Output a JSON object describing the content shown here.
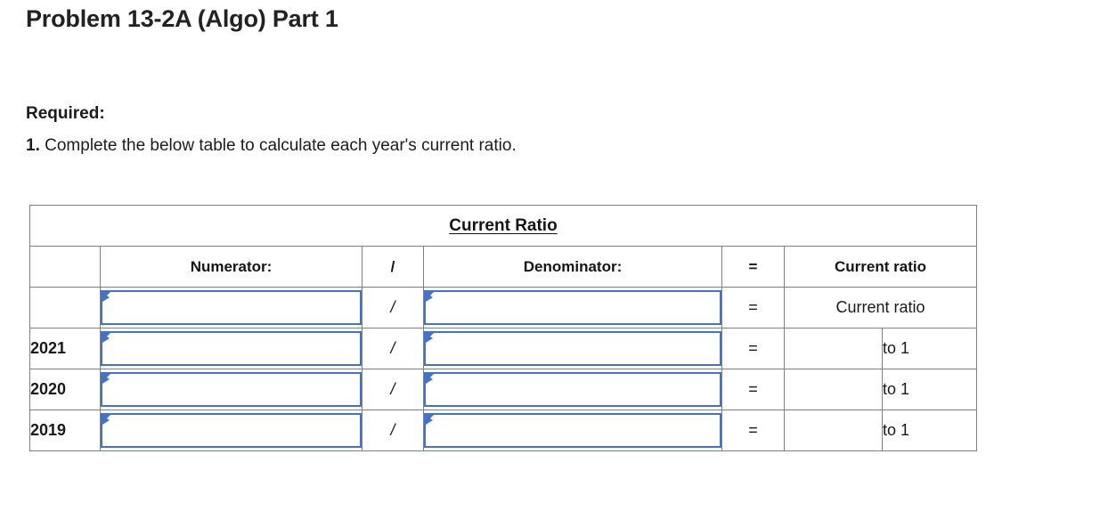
{
  "page": {
    "title": "Problem 13-2A (Algo) Part 1",
    "required_label": "Required:",
    "instruction_number": "1.",
    "instruction_text": " Complete the below table to calculate each year's current ratio."
  },
  "colors": {
    "header_blue": "#85AFE3",
    "input_border_blue": "#4472C4",
    "grid_border": "#808080",
    "text": "#1a1a1a",
    "background": "#ffffff"
  },
  "table": {
    "title": "Current Ratio",
    "columns": {
      "label": "",
      "numerator": "Numerator:",
      "slash": "/",
      "denominator": "Denominator:",
      "equals": "=",
      "result": "Current ratio"
    },
    "rows": [
      {
        "label": "",
        "numerator_value": "",
        "slash": "/",
        "denominator_value": "",
        "equals": "=",
        "result_text": "Current ratio",
        "result_value": "",
        "suffix": "",
        "split_result": false
      },
      {
        "label": "2021",
        "numerator_value": "",
        "slash": "/",
        "denominator_value": "",
        "equals": "=",
        "result_text": "",
        "result_value": "",
        "suffix": "to 1",
        "split_result": true
      },
      {
        "label": "2020",
        "numerator_value": "",
        "slash": "/",
        "denominator_value": "",
        "equals": "=",
        "result_text": "",
        "result_value": "",
        "suffix": "to 1",
        "split_result": true
      },
      {
        "label": "2019",
        "numerator_value": "",
        "slash": "/",
        "denominator_value": "",
        "equals": "=",
        "result_text": "",
        "result_value": "",
        "suffix": "to 1",
        "split_result": true
      }
    ]
  }
}
